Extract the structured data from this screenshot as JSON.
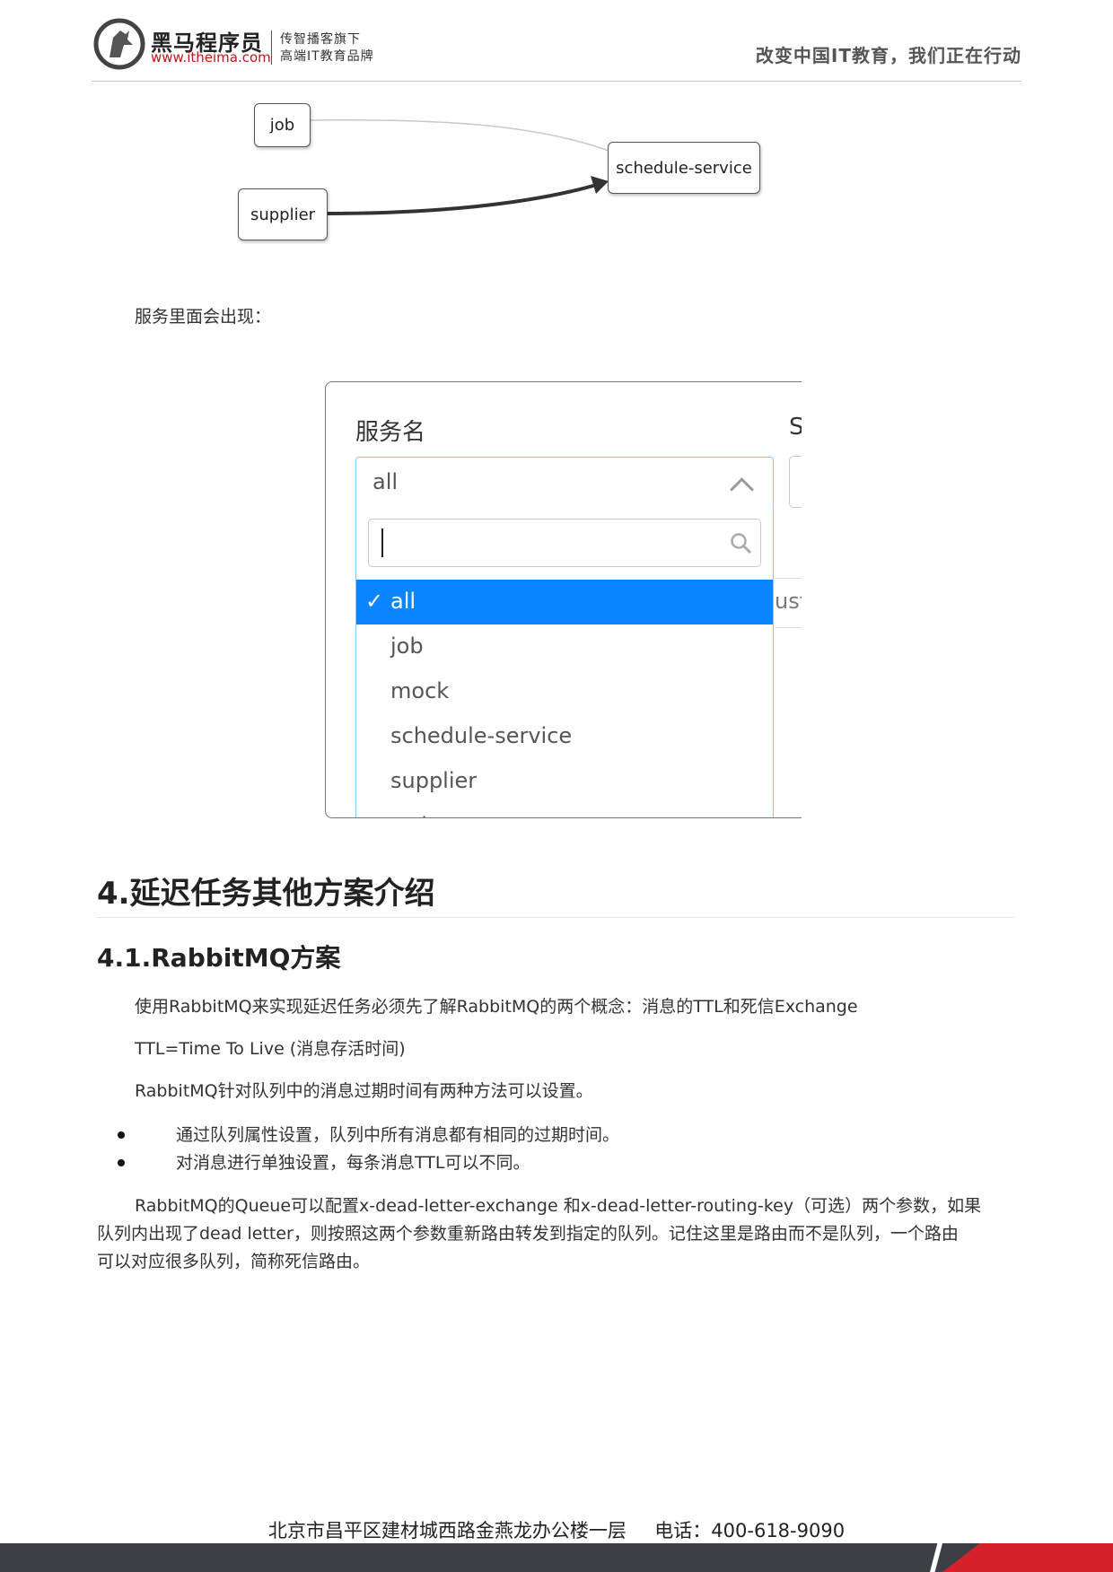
{
  "header": {
    "brand_name": "黑马程序员",
    "brand_url": "www.itheima.com",
    "tagline_1": "传智播客旗下",
    "tagline_2": "高端IT教育品牌",
    "slogan": "改变中国IT教育，我们正在行动"
  },
  "diagram": {
    "nodes": [
      "job",
      "supplier",
      "schedule-service"
    ]
  },
  "intro_text": "服务里面会出现：",
  "screenshot": {
    "label": "服务名",
    "second_label_fragment": "S",
    "selected_value": "all",
    "search_placeholder": "",
    "check_glyph": "✓",
    "behind_fragment": "ust",
    "options": [
      "all",
      "job",
      "mock",
      "schedule-service",
      "supplier",
      "web"
    ]
  },
  "section": {
    "h1": "4.延迟任务其他方案介绍",
    "h2": "4.1.RabbitMQ方案",
    "p1": "使用RabbitMQ来实现延迟任务必须先了解RabbitMQ的两个概念：消息的TTL和死信Exchange",
    "p2": "TTL=Time To Live (消息存活时间)",
    "p3": "RabbitMQ针对队列中的消息过期时间有两种方法可以设置。",
    "bullets": [
      "通过队列属性设置，队列中所有消息都有相同的过期时间。",
      "对消息进行单独设置，每条消息TTL可以不同。"
    ],
    "p4_lines": [
      "RabbitMQ的Queue可以配置x-dead-letter-exchange 和x-dead-letter-routing-key（可选）两个参数，如果",
      "队列内出现了dead letter，则按照这两个参数重新路由转发到指定的队列。记住这里是路由而不是队列，一个路由",
      "可以对应很多队列，简称死信路由。"
    ]
  },
  "footer": {
    "address": "北京市昌平区建材城西路金燕龙办公楼一层",
    "phone_label": "电话：",
    "phone": "400-618-9090"
  },
  "colors": {
    "accent_red": "#d7212a",
    "selected_blue": "#0a84ff",
    "input_border": "#8ec4ee",
    "footer_dark": "#3c4044"
  }
}
